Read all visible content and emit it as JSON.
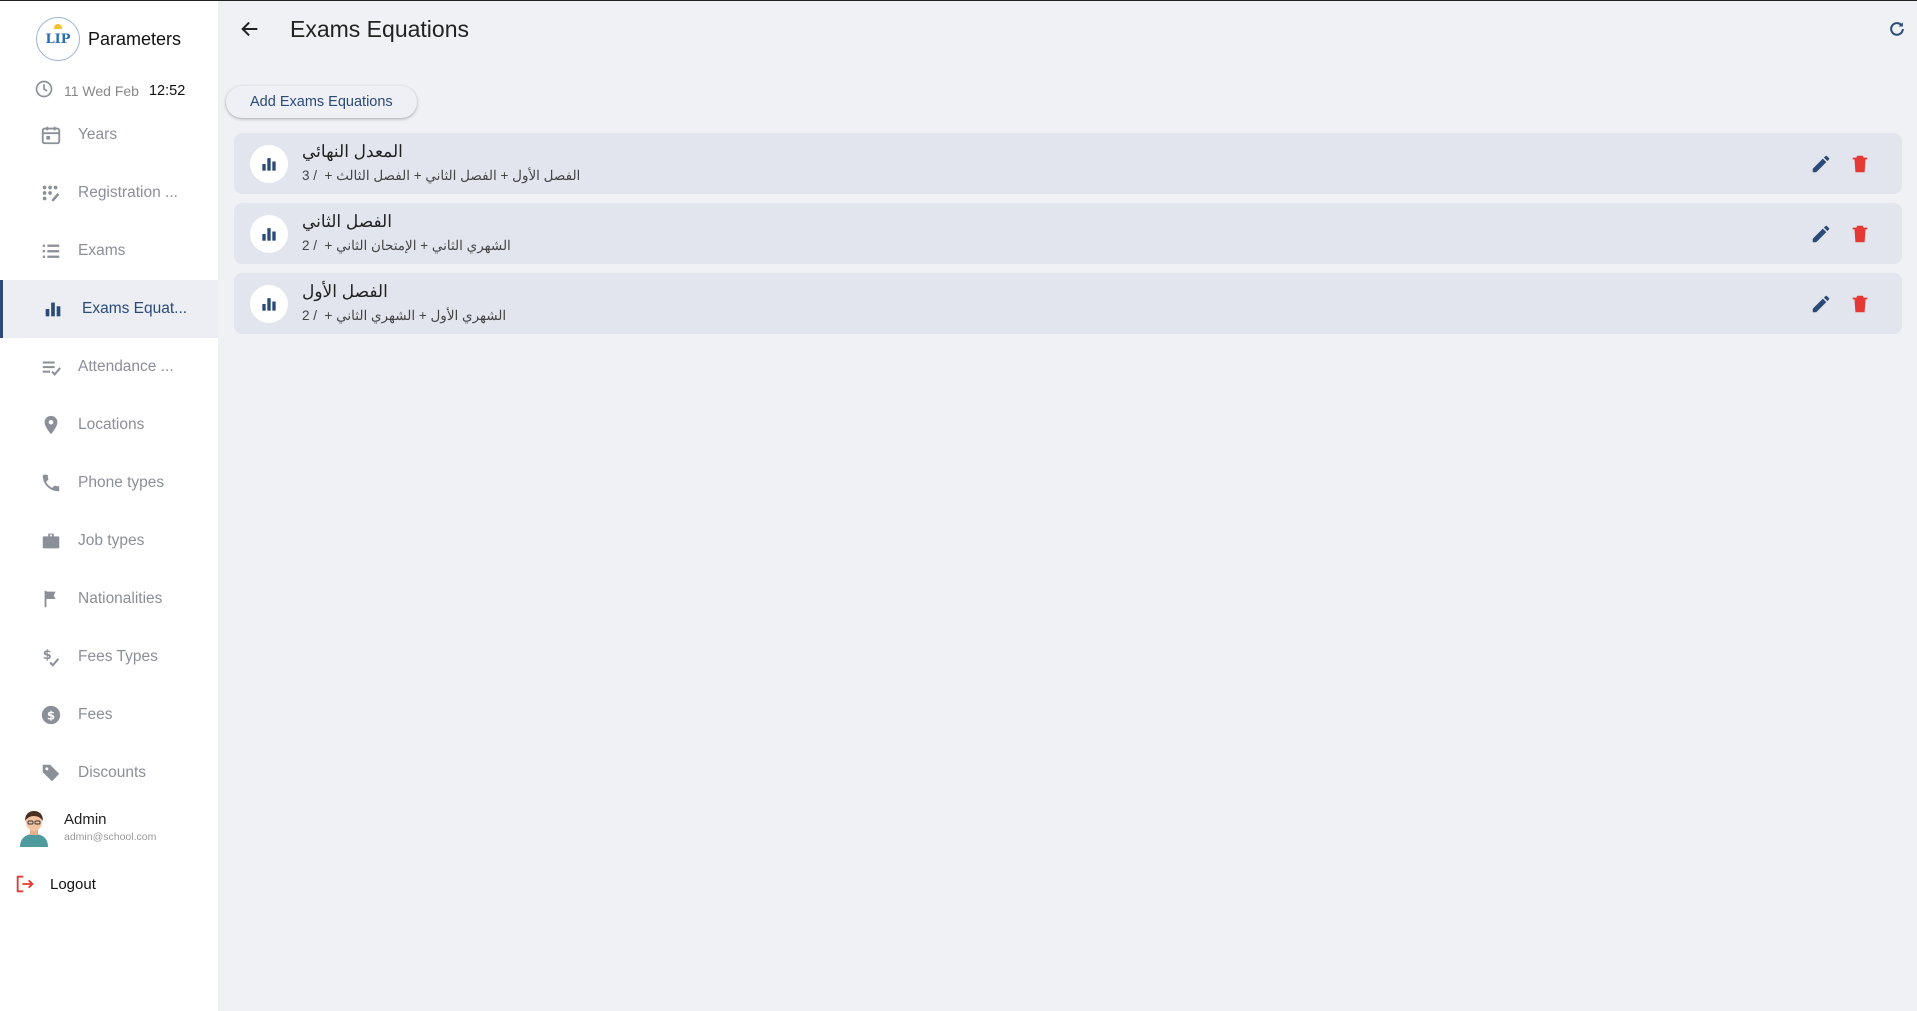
{
  "app": {
    "title": "Parameters",
    "logo_text": "LIP"
  },
  "datetime": {
    "date": "11 Wed Feb",
    "time": "12:52"
  },
  "sidebar": {
    "items": [
      {
        "label": "Years",
        "icon": "calendar-icon"
      },
      {
        "label": "Registration ...",
        "icon": "registration-icon"
      },
      {
        "label": "Exams",
        "icon": "list-icon"
      },
      {
        "label": "Exams Equat...",
        "icon": "bar-chart-icon",
        "active": true
      },
      {
        "label": "Attendance ...",
        "icon": "checklist-icon"
      },
      {
        "label": "Locations",
        "icon": "location-pin-icon"
      },
      {
        "label": "Phone types",
        "icon": "phone-icon"
      },
      {
        "label": "Job types",
        "icon": "briefcase-icon"
      },
      {
        "label": "Nationalities",
        "icon": "flag-icon"
      },
      {
        "label": "Fees Types",
        "icon": "fee-type-icon"
      },
      {
        "label": "Fees",
        "icon": "dollar-circle-icon"
      },
      {
        "label": "Discounts",
        "icon": "tag-icon"
      }
    ]
  },
  "user": {
    "name": "Admin",
    "email": "admin@school.com"
  },
  "logout": {
    "label": "Logout"
  },
  "header": {
    "title": "Exams Equations"
  },
  "actions": {
    "add_label": "Add Exams Equations"
  },
  "equations": [
    {
      "title": "المعدل النهائي",
      "subtitle": "3 /  + الفصل الأول + الفصل الثاني + الفصل الثالث"
    },
    {
      "title": "الفصل الثاني",
      "subtitle": "2 /  + الشهري الثاني + الإمتحان الثاني"
    },
    {
      "title": "الفصل الأول",
      "subtitle": "2 /  + الشهري الأول + الشهري الثاني"
    }
  ],
  "colors": {
    "accent": "#2b4a78",
    "delete": "#e53935",
    "active_bg": "#eceef3",
    "row_bg": "#e2e5ed"
  }
}
